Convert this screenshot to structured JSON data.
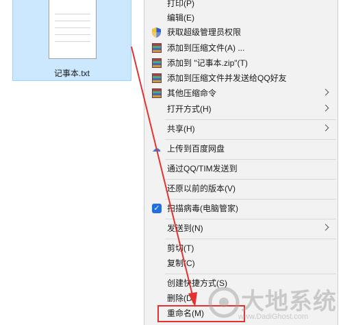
{
  "desktop": {
    "file_name": "记事本.txt"
  },
  "menu": {
    "items": [
      {
        "label": "打印(P)",
        "icon": "",
        "submenu": false
      },
      {
        "label": "编辑(E)",
        "icon": "",
        "submenu": false
      },
      {
        "label": "获取超级管理员权限",
        "icon": "shield-icon",
        "submenu": false
      },
      {
        "label": "添加到压缩文件(A) ...",
        "icon": "winrar-icon",
        "submenu": false
      },
      {
        "label": "添加到 \"记事本.zip\"(T)",
        "icon": "winrar-icon",
        "submenu": false
      },
      {
        "label": "添加到压缩文件并发送给QQ好友",
        "icon": "winrar-icon",
        "submenu": false
      },
      {
        "label": "其他压缩命令",
        "icon": "winrar-icon",
        "submenu": true
      },
      {
        "label": "打开方式(H)",
        "icon": "",
        "submenu": true
      },
      {
        "label": "共享(H)",
        "icon": "",
        "submenu": true
      },
      {
        "label": "上传到百度网盘",
        "icon": "baidu-cloud-icon",
        "submenu": false
      },
      {
        "label": "通过QQ/TIM发送到",
        "icon": "",
        "submenu": false
      },
      {
        "label": "还原以前的版本(V)",
        "icon": "",
        "submenu": false
      },
      {
        "label": "扫描病毒(电脑管家)",
        "icon": "tencent-pc-manager-icon",
        "submenu": false
      },
      {
        "label": "发送到(N)",
        "icon": "",
        "submenu": true
      },
      {
        "label": "剪切(T)",
        "icon": "",
        "submenu": false
      },
      {
        "label": "复制(C)",
        "icon": "",
        "submenu": false
      },
      {
        "label": "创建快捷方式(S)",
        "icon": "",
        "submenu": false
      },
      {
        "label": "删除(D)",
        "icon": "",
        "submenu": false
      },
      {
        "label": "重命名(M)",
        "icon": "",
        "submenu": false
      }
    ]
  },
  "annotation": {
    "highlight_color": "#e53030",
    "highlighted_item": "重命名(M)"
  },
  "watermark": {
    "title": "大地系统",
    "subtitle": "www.DadiGhost.com"
  }
}
